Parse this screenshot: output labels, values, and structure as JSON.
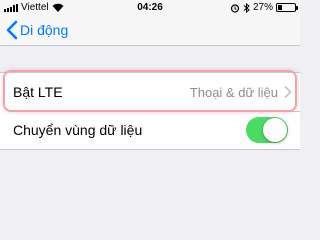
{
  "status_bar": {
    "carrier": "Viettel",
    "time": "04:26",
    "battery_percent": "27%",
    "battery_level": 0.27
  },
  "nav": {
    "back_label": "Di động"
  },
  "settings": {
    "lte": {
      "label": "Bật LTE",
      "value": "Thoại & dữ liệu"
    },
    "roaming": {
      "label": "Chuyển vùng dữ liệu",
      "enabled": true
    }
  },
  "colors": {
    "accent": "#007aff",
    "toggle_on": "#4cd964",
    "highlight": "#f0a5ab",
    "background": "#efeff4"
  }
}
